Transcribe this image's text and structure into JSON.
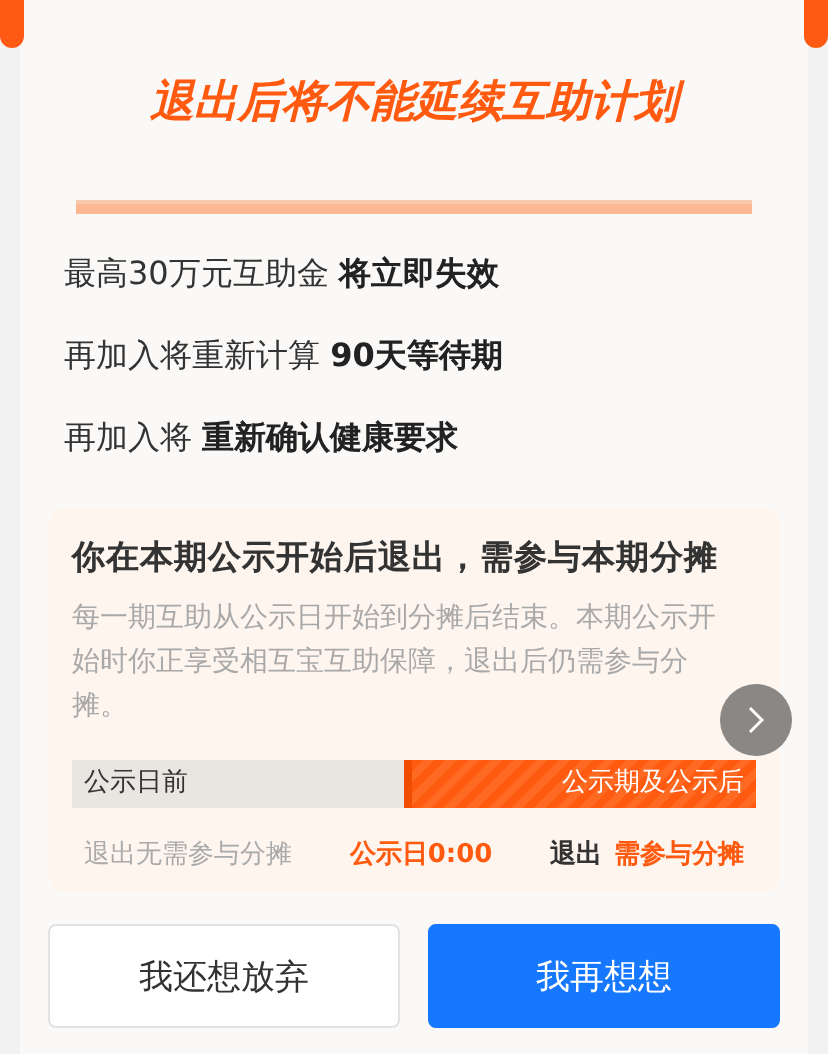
{
  "title": "退出后将不能延续互助计划",
  "points": [
    "最高30万元互助金 **将立即失效**",
    "再加入将重新计算 **90天等待期**",
    "再加入将 **重新确认健康要求**"
  ],
  "notice": {
    "heading": "你在本期公示开始后退出，需参与本期分摊",
    "body": "每一期互助从公示日开始到分摊后结束。本期公示开始时你正享受相互宝互助保障，退出后仍需参与分摊。",
    "timeline": {
      "before_label": "公示日前",
      "after_label": "公示期及公示后",
      "before_note": "退出无需参与分摊",
      "marker": "公示日0:00",
      "after_note_prefix": "退出",
      "after_note": "需参与分摊"
    }
  },
  "buttons": [
    {
      "label": "我还想放弃",
      "kind": "secondary"
    },
    {
      "label": "我再想想",
      "kind": "primary"
    }
  ]
}
